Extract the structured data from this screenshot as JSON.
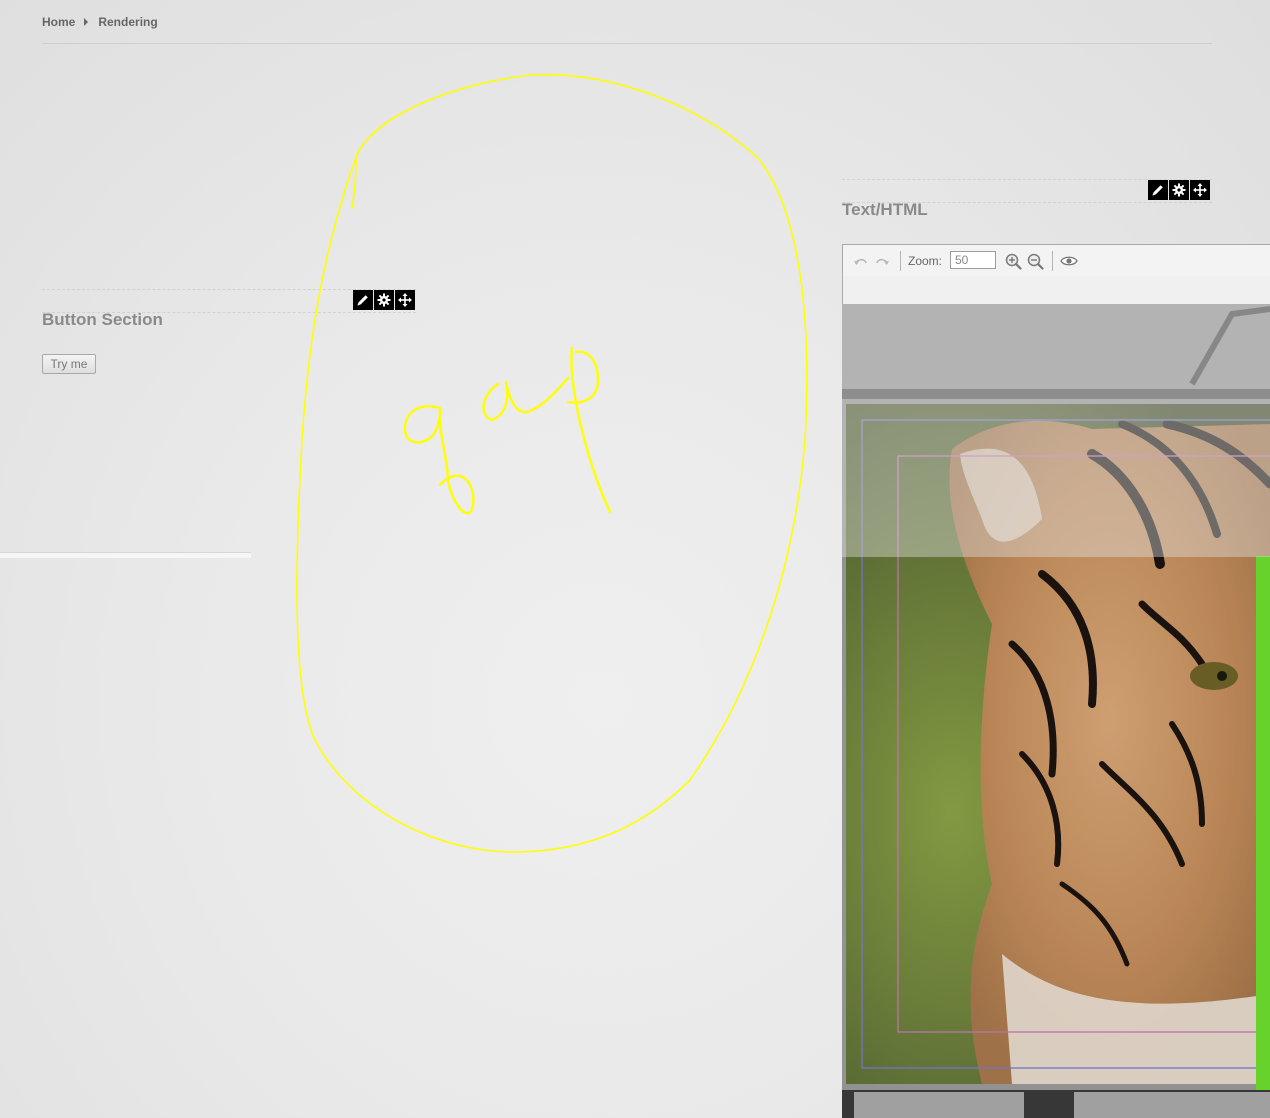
{
  "breadcrumb": {
    "home": "Home",
    "current": "Rendering"
  },
  "button_section": {
    "title": "Button Section",
    "button_label": "Try me",
    "controls": [
      "pencil-icon",
      "gear-icon",
      "move-icon"
    ]
  },
  "text_html_section": {
    "title": "Text/HTML",
    "controls": [
      "pencil-icon",
      "gear-icon",
      "move-icon"
    ]
  },
  "editor_toolbar": {
    "undo_icon": "undo-icon",
    "redo_icon": "redo-icon",
    "zoom_label": "Zoom:",
    "zoom_value": "50",
    "zoom_in_icon": "zoom-in-icon",
    "zoom_out_icon": "zoom-out-icon",
    "preview_icon": "eye-icon"
  },
  "annotation": {
    "handwritten_text": "gap",
    "color": "#ffff00"
  },
  "colors": {
    "guide_blue": "#7b7bd6",
    "guide_pink": "#c77ab8",
    "highlight_green": "#6dde2e"
  }
}
